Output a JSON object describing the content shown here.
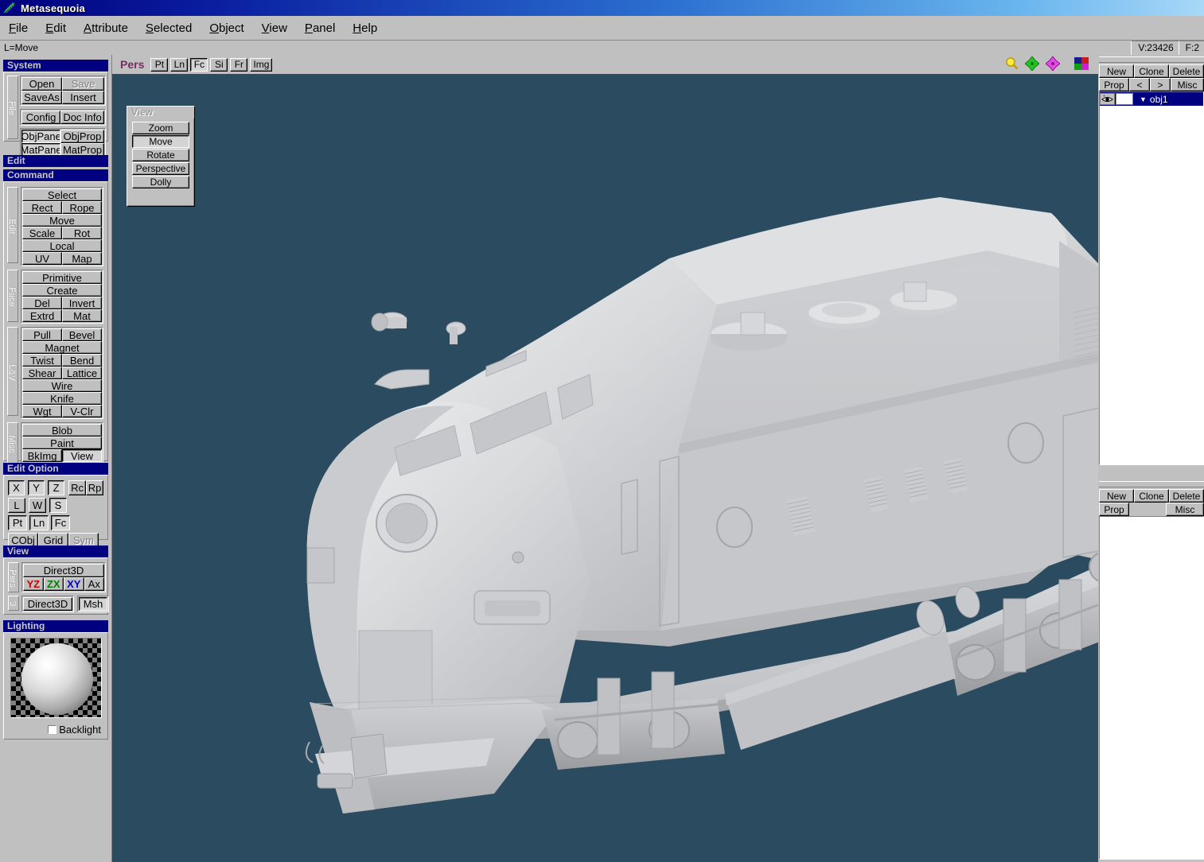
{
  "window": {
    "title": "Metasequoia",
    "icon": "fern-leaf-icon"
  },
  "menu": {
    "items": [
      {
        "label": "File"
      },
      {
        "label": "Edit"
      },
      {
        "label": "Attribute"
      },
      {
        "label": "Selected"
      },
      {
        "label": "Object"
      },
      {
        "label": "View"
      },
      {
        "label": "Panel"
      },
      {
        "label": "Help"
      }
    ]
  },
  "statusbar": {
    "hint": "L=Move",
    "vertices": "V:23426",
    "faces": "F:2"
  },
  "sidebar": {
    "system": {
      "title": "System",
      "vtab": "File",
      "buttons": [
        {
          "label": "Open",
          "state": "up"
        },
        {
          "label": "Save",
          "state": "disabled"
        },
        {
          "label": "SaveAs",
          "state": "up"
        },
        {
          "label": "Insert",
          "state": "up"
        },
        {
          "label": "Config",
          "state": "up"
        },
        {
          "label": "Doc Info",
          "state": "up"
        },
        {
          "label": "ObjPane",
          "state": "down"
        },
        {
          "label": "ObjProp",
          "state": "up"
        },
        {
          "label": "MatPane",
          "state": "down"
        },
        {
          "label": "MatProp",
          "state": "up"
        }
      ]
    },
    "edit": {
      "title": "Edit"
    },
    "command": {
      "title": "Command",
      "groups": [
        {
          "vtab": "Edit",
          "rows": [
            [
              {
                "label": "Select",
                "state": "up"
              }
            ],
            [
              {
                "label": "Rect",
                "state": "up"
              },
              {
                "label": "Rope",
                "state": "up"
              }
            ],
            [
              {
                "label": "Move",
                "state": "up"
              }
            ],
            [
              {
                "label": "Scale",
                "state": "up"
              },
              {
                "label": "Rot",
                "state": "up"
              }
            ],
            [
              {
                "label": "Local",
                "state": "up"
              }
            ],
            [
              {
                "label": "UV",
                "state": "up"
              },
              {
                "label": "Map",
                "state": "up"
              }
            ]
          ]
        },
        {
          "vtab": "Face",
          "rows": [
            [
              {
                "label": "Primitive",
                "state": "up"
              }
            ],
            [
              {
                "label": "Create",
                "state": "up"
              }
            ],
            [
              {
                "label": "Del",
                "state": "up"
              },
              {
                "label": "Invert",
                "state": "up"
              }
            ],
            [
              {
                "label": "Extrd",
                "state": "up"
              },
              {
                "label": "Mat",
                "state": "up"
              }
            ]
          ]
        },
        {
          "vtab": "L&V",
          "rows": [
            [
              {
                "label": "Pull",
                "state": "up"
              },
              {
                "label": "Bevel",
                "state": "up"
              }
            ],
            [
              {
                "label": "Magnet",
                "state": "up"
              }
            ],
            [
              {
                "label": "Twist",
                "state": "up"
              },
              {
                "label": "Bend",
                "state": "up"
              }
            ],
            [
              {
                "label": "Shear",
                "state": "up"
              },
              {
                "label": "Lattice",
                "state": "up"
              }
            ],
            [
              {
                "label": "Wire",
                "state": "up"
              }
            ],
            [
              {
                "label": "Knife",
                "state": "up"
              }
            ],
            [
              {
                "label": "Wgt",
                "state": "up"
              },
              {
                "label": "V-Clr",
                "state": "up"
              }
            ]
          ]
        },
        {
          "vtab": "Misc",
          "rows": [
            [
              {
                "label": "Blob",
                "state": "up"
              }
            ],
            [
              {
                "label": "Paint",
                "state": "up"
              }
            ],
            [
              {
                "label": "BkImg",
                "state": "up"
              },
              {
                "label": "View",
                "state": "down"
              }
            ]
          ]
        }
      ]
    },
    "edit_option": {
      "title": "Edit Option",
      "rows": [
        [
          {
            "label": "X",
            "state": "down"
          },
          {
            "label": "Y",
            "state": "down"
          },
          {
            "label": "Z",
            "state": "down"
          },
          {
            "label": "Rc",
            "state": "up"
          },
          {
            "label": "Rp",
            "state": "up"
          }
        ],
        [
          {
            "label": "L",
            "state": "up"
          },
          {
            "label": "W",
            "state": "up"
          },
          {
            "label": "S",
            "state": "down"
          }
        ],
        [
          {
            "label": "Pt",
            "state": "down"
          },
          {
            "label": "Ln",
            "state": "down"
          },
          {
            "label": "Fc",
            "state": "down"
          }
        ],
        [
          {
            "label": "CObj",
            "state": "up"
          },
          {
            "label": "Grid",
            "state": "up"
          },
          {
            "label": "Sym",
            "state": "disabled"
          }
        ]
      ]
    },
    "view": {
      "title": "View",
      "vtab_pers": "Pers",
      "vtab_3": "3",
      "direct3d_label": "Direct3D",
      "axes": [
        {
          "label": "YZ",
          "color": "#cc0000"
        },
        {
          "label": "ZX",
          "color": "#008000"
        },
        {
          "label": "XY",
          "color": "#0000cc"
        }
      ],
      "ax_label": "Ax",
      "direct3d_small": "Direct3D",
      "msh_label": "Msh"
    },
    "lighting": {
      "title": "Lighting",
      "backlight_label": "Backlight",
      "backlight_checked": false,
      "preview": "light-sphere-preview"
    }
  },
  "viewport": {
    "toolbar": {
      "mode_label": "Pers",
      "buttons": [
        {
          "label": "Pt",
          "state": "up"
        },
        {
          "label": "Ln",
          "state": "up"
        },
        {
          "label": "Fc",
          "state": "down"
        },
        {
          "label": "Si",
          "state": "up"
        },
        {
          "label": "Fr",
          "state": "up"
        },
        {
          "label": "Img",
          "state": "up"
        }
      ],
      "tools": [
        {
          "name": "magnifier-icon"
        },
        {
          "name": "move-axis-icon"
        },
        {
          "name": "rotate-axis-icon"
        },
        {
          "name": "color-palette-icon"
        }
      ]
    },
    "background_color": "#2b4c60",
    "model_color": "#c8c9cb",
    "model_description": "diesel locomotive 3d model, shaded gray, perspective view",
    "float_panel": {
      "title": "View",
      "buttons": [
        {
          "label": "Zoom",
          "state": "up"
        },
        {
          "label": "Move",
          "state": "down"
        },
        {
          "label": "Rotate",
          "state": "up"
        },
        {
          "label": "Perspective",
          "state": "up"
        },
        {
          "label": "Dolly",
          "state": "up"
        }
      ]
    }
  },
  "object_panel": {
    "row1": [
      {
        "label": "New"
      },
      {
        "label": "Clone"
      },
      {
        "label": "Delete"
      }
    ],
    "row2": [
      {
        "label": "Prop"
      },
      {
        "label": "<"
      },
      {
        "label": ">"
      },
      {
        "label": "Misc"
      }
    ],
    "objects": [
      {
        "name": "obj1",
        "visible": true,
        "color": "#ffffff",
        "selected": true
      }
    ]
  },
  "material_panel": {
    "row1": [
      {
        "label": "New"
      },
      {
        "label": "Clone"
      },
      {
        "label": "Delete"
      }
    ],
    "row2": [
      {
        "label": "Prop"
      },
      {
        "label": ""
      },
      {
        "label": "Misc"
      }
    ],
    "materials": []
  }
}
